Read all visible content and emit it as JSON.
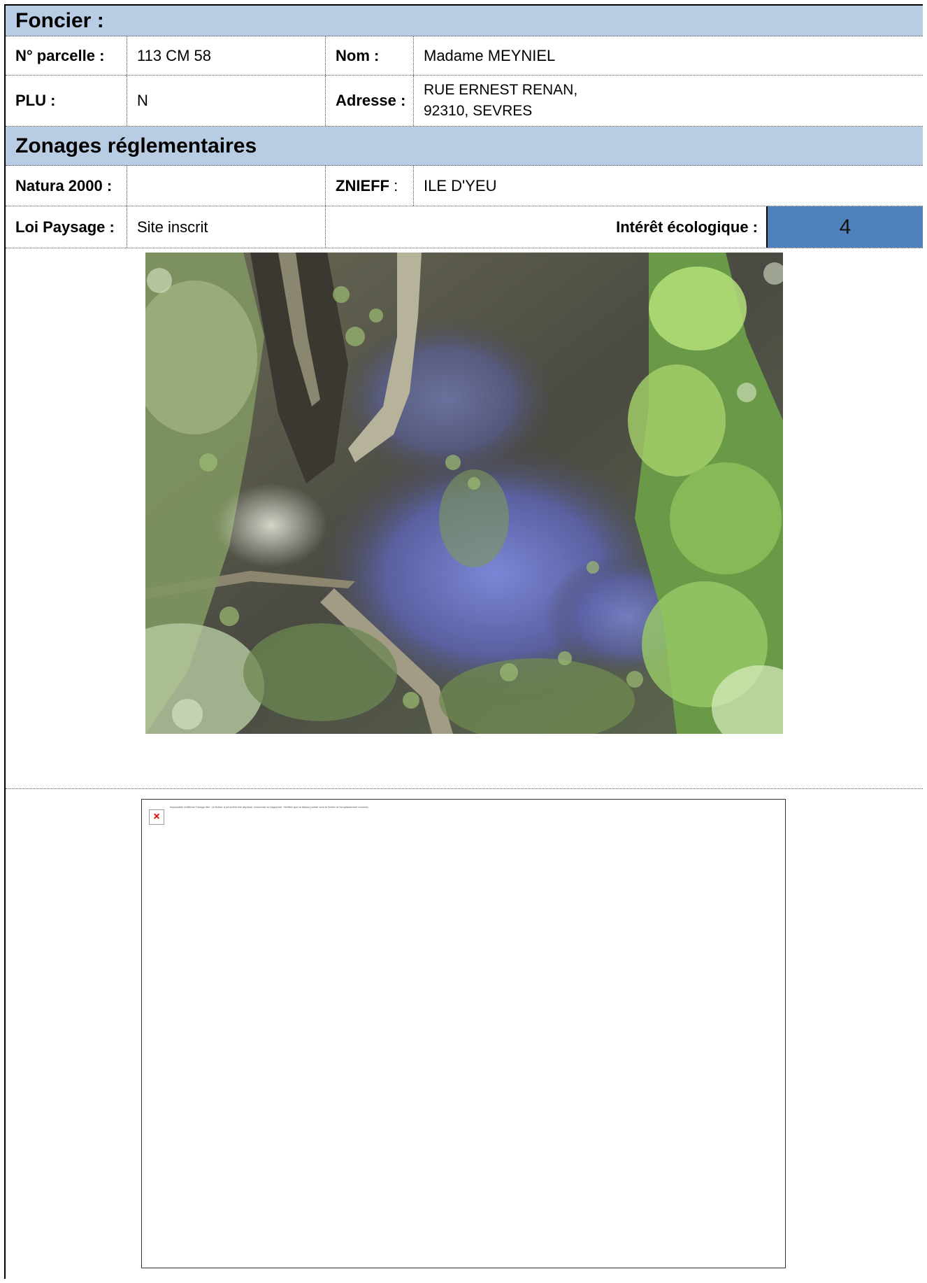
{
  "foncier": {
    "header": "Foncier :",
    "parcelle_label": "N° parcelle :",
    "parcelle_value": "113 CM 58",
    "nom_label": "Nom :",
    "nom_value": "Madame MEYNIEL",
    "plu_label": "PLU :",
    "plu_value": "N",
    "adresse_label": "Adresse :",
    "adresse_line1": "RUE ERNEST RENAN,",
    "adresse_line2": "92310, SEVRES"
  },
  "zonages": {
    "header": "Zonages réglementaires",
    "natura_label": "Natura 2000 :",
    "natura_value": "",
    "znieff_label": "ZNIEFF",
    "znieff_colon": " :",
    "znieff_value": "ILE D'YEU",
    "loi_label": "Loi Paysage :",
    "loi_value": "Site inscrit",
    "interet_label": "Intérêt écologique :",
    "interet_value": "4"
  },
  "images": {
    "broken_icon": "×",
    "broken_message": "Impossible d'afficher l'image liée. Le fichier a peut-être été déplacé, renommé ou supprimé. Vérifiez que la liaison pointe vers le fichier et l'emplacement corrects."
  },
  "colors": {
    "section_header_bg": "#b8cce4",
    "score_bg": "#4f81bd"
  }
}
